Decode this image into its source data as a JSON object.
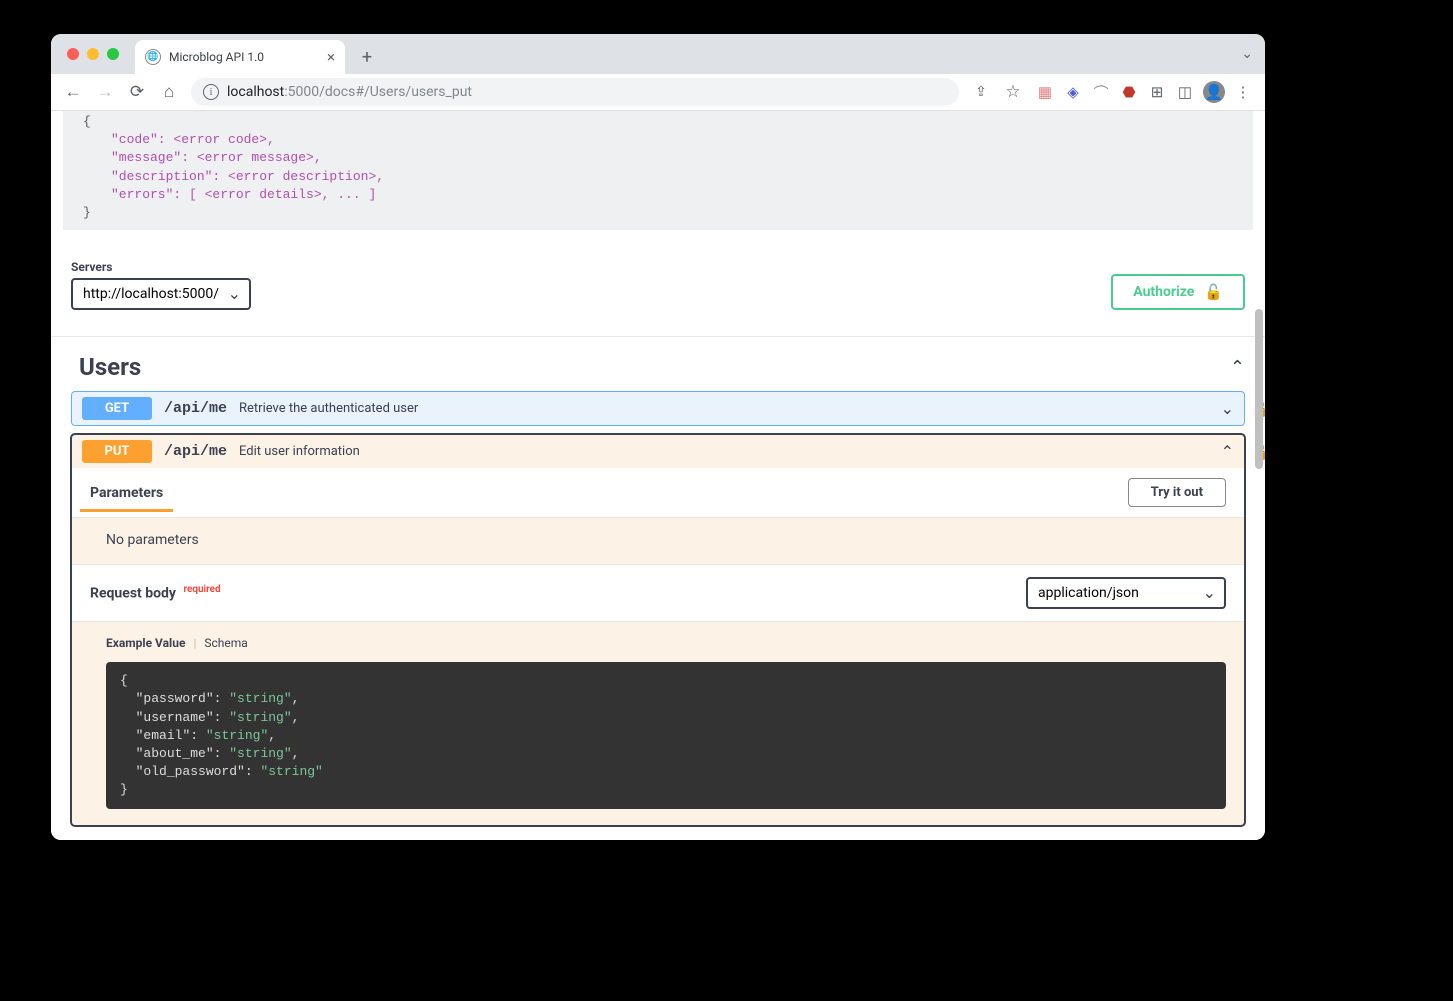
{
  "browser": {
    "tab_title": "Microblog API 1.0",
    "url_host": "localhost",
    "url_port_path": ":5000/docs#/Users/users_put"
  },
  "error_schema": {
    "line1": "\"code\": <error code>,",
    "line2": "\"message\": <error message>,",
    "line3": "\"description\": <error description>,",
    "line4": "\"errors\": [ <error details>, ... ]"
  },
  "servers": {
    "label": "Servers",
    "selected": "http://localhost:5000/"
  },
  "authorize_label": "Authorize",
  "tag": {
    "name": "Users"
  },
  "ops": {
    "get": {
      "method": "GET",
      "path": "/api/me",
      "summary": "Retrieve the authenticated user"
    },
    "put": {
      "method": "PUT",
      "path": "/api/me",
      "summary": "Edit user information"
    }
  },
  "parameters": {
    "title": "Parameters",
    "try_label": "Try it out",
    "empty": "No parameters"
  },
  "request_body": {
    "title": "Request body",
    "required_label": "required",
    "content_type": "application/json",
    "tabs": {
      "example": "Example Value",
      "schema": "Schema"
    },
    "example_fields": [
      {
        "key": "password",
        "value": "string"
      },
      {
        "key": "username",
        "value": "string"
      },
      {
        "key": "email",
        "value": "string"
      },
      {
        "key": "about_me",
        "value": "string"
      },
      {
        "key": "old_password",
        "value": "string"
      }
    ]
  }
}
